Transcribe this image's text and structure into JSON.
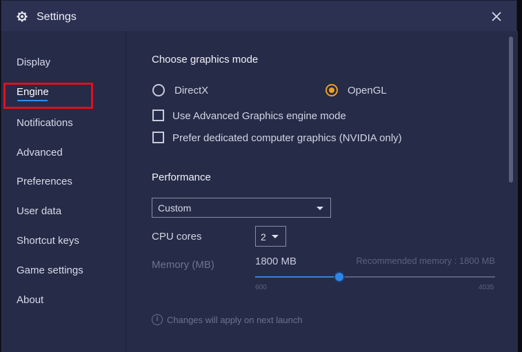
{
  "window": {
    "title": "Settings",
    "icons": {
      "settings": "gear-icon",
      "close": "close-icon"
    }
  },
  "sidebar": {
    "items": [
      {
        "label": "Display"
      },
      {
        "label": "Engine",
        "active": true
      },
      {
        "label": "Notifications"
      },
      {
        "label": "Advanced"
      },
      {
        "label": "Preferences"
      },
      {
        "label": "User data"
      },
      {
        "label": "Shortcut keys"
      },
      {
        "label": "Game settings"
      },
      {
        "label": "About"
      }
    ]
  },
  "graphics": {
    "section_title": "Choose graphics mode",
    "directx_label": "DirectX",
    "opengl_label": "OpenGL",
    "selected_mode": "OpenGL",
    "advanced_engine_label": "Use Advanced Graphics engine mode",
    "advanced_engine_checked": false,
    "dedicated_gpu_label": "Prefer dedicated computer graphics (NVIDIA only)",
    "dedicated_gpu_checked": false
  },
  "performance": {
    "section_title": "Performance",
    "preset_value": "Custom",
    "cpu_label": "CPU cores",
    "cpu_value": "2",
    "memory_label": "Memory (MB)",
    "memory_value": "1800 MB",
    "recommended_text": "Recommended memory : 1800 MB",
    "slider_min": "600",
    "slider_max": "4035",
    "slider_value": 1800
  },
  "footer": {
    "info_text": "Changes will apply on next launch"
  },
  "colors": {
    "accent_orange": "#f0a020",
    "accent_blue": "#2f86e8",
    "highlight_red": "#e0101c",
    "background": "#262b47"
  }
}
